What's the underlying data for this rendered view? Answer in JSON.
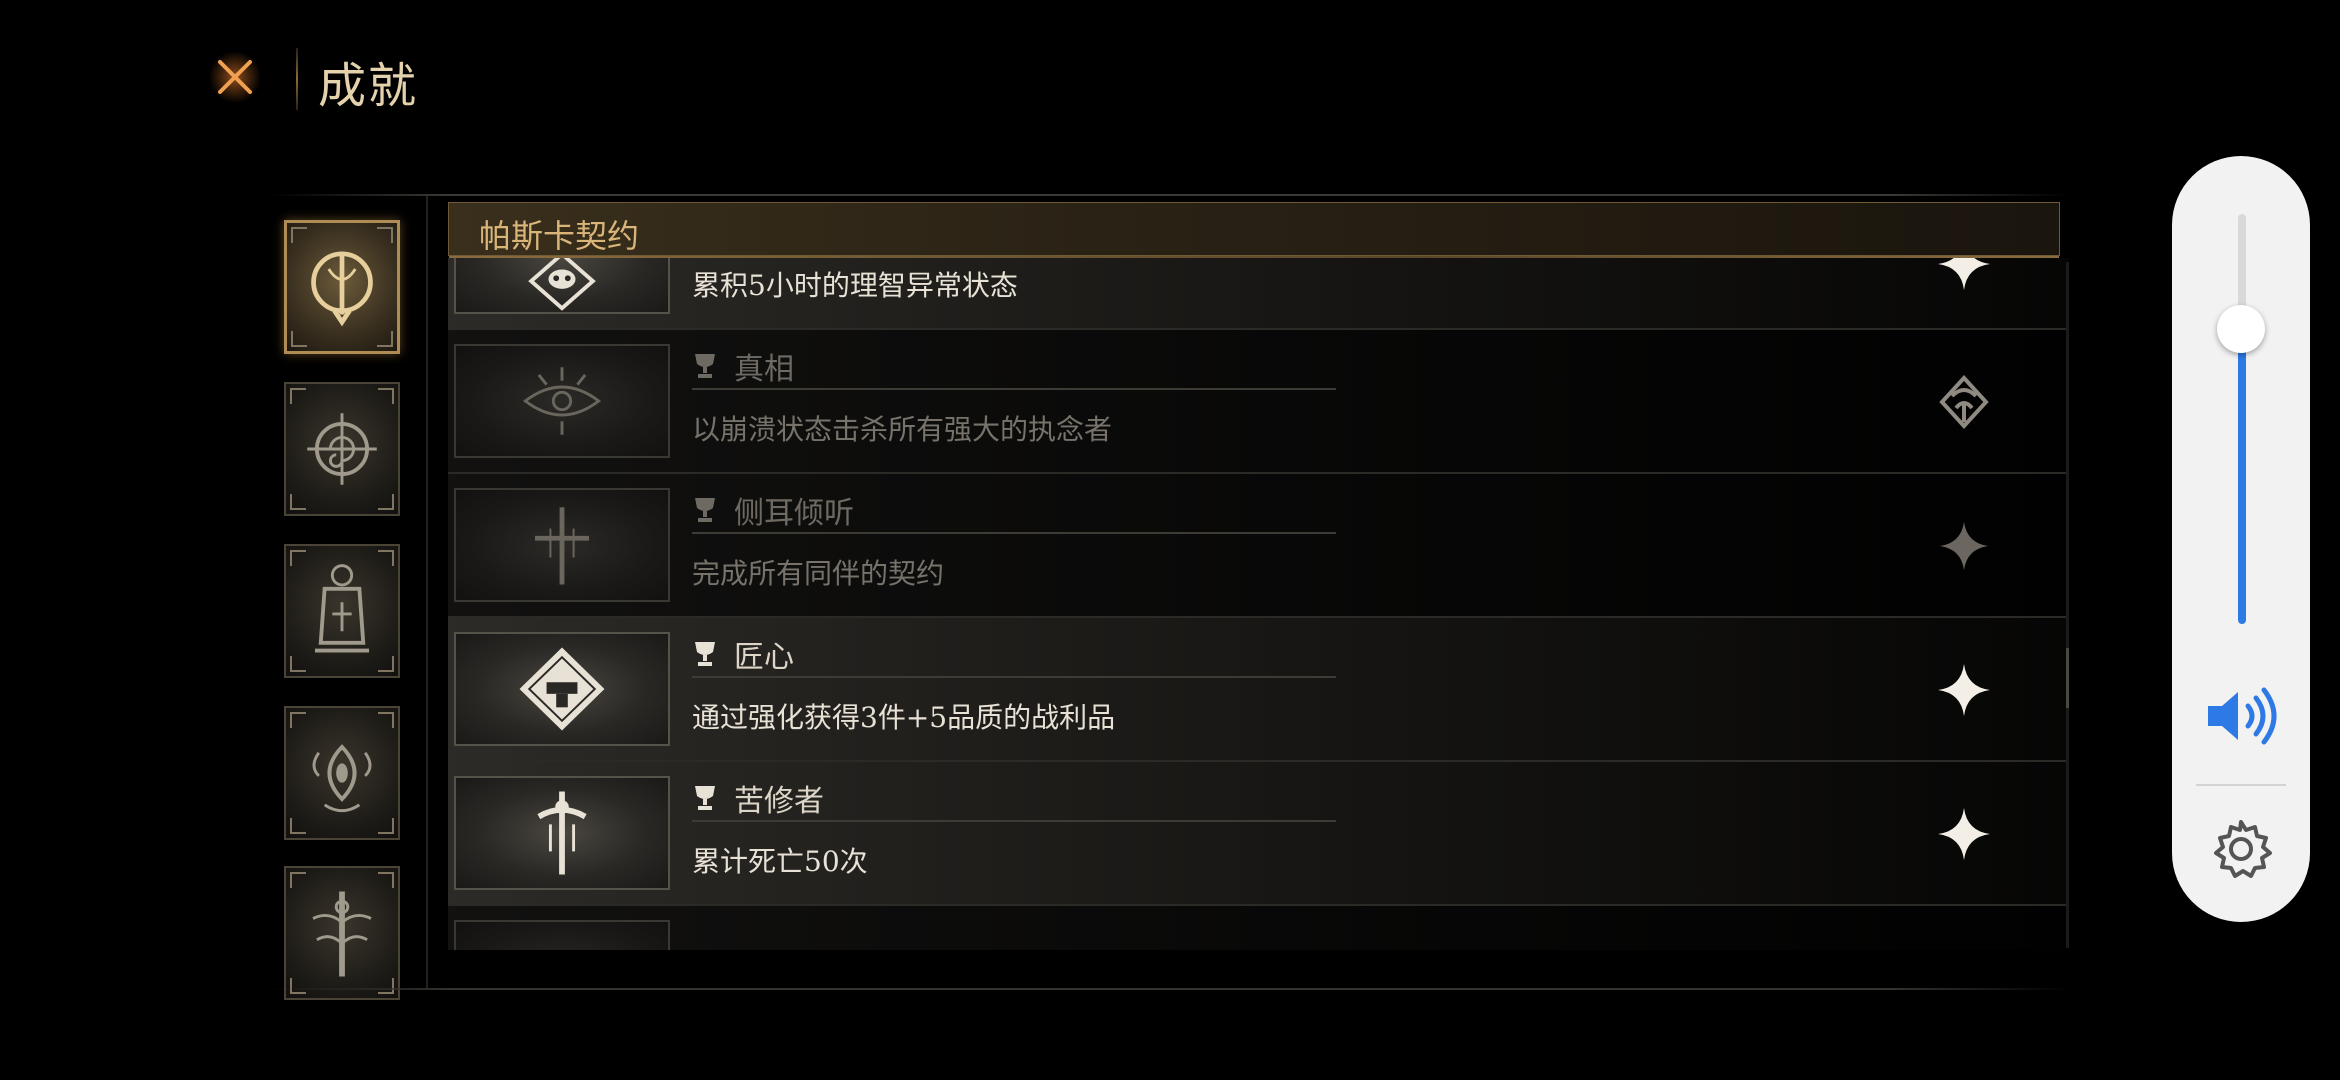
{
  "header": {
    "title": "成就",
    "close_icon": "close-x-icon"
  },
  "sidebar": {
    "items": [
      {
        "icon": "pascal-contract-emblem-icon",
        "active": true
      },
      {
        "icon": "compass-spiral-emblem-icon",
        "active": false
      },
      {
        "icon": "lantern-emblem-icon",
        "active": false
      },
      {
        "icon": "eye-sigil-emblem-icon",
        "active": false
      },
      {
        "icon": "ornate-dagger-emblem-icon",
        "active": false
      }
    ]
  },
  "section": {
    "title": "帕斯卡契约"
  },
  "achievements": [
    {
      "name": "",
      "description": "累积5小时的理智异常状态",
      "state": "unlocked",
      "icon": "skull-crest-icon",
      "status_icon": "four-point-star-icon"
    },
    {
      "name": "真相",
      "description": "以崩溃状态击杀所有强大的执念者",
      "state": "locked",
      "icon": "eye-sigil-icon",
      "status_icon": "faction-crest-icon"
    },
    {
      "name": "侧耳倾听",
      "description": "完成所有同伴的契约",
      "state": "locked",
      "icon": "cross-sigil-icon",
      "status_icon": "four-point-star-icon"
    },
    {
      "name": "匠心",
      "description": "通过强化获得3件+5品质的战利品",
      "state": "unlocked",
      "icon": "anvil-diamond-icon",
      "status_icon": "four-point-star-icon"
    },
    {
      "name": "苦修者",
      "description": "累计死亡50次",
      "state": "unlocked",
      "icon": "dagger-cross-icon",
      "status_icon": "four-point-star-icon"
    }
  ],
  "volume": {
    "level": 0.72,
    "speaker_icon": "speaker-volume-icon",
    "settings_icon": "gear-icon",
    "accent": "#2d7ae6"
  },
  "colors": {
    "gold": "#d9b57a",
    "text": "#e8e2d6",
    "locked_text": "#77736b"
  }
}
